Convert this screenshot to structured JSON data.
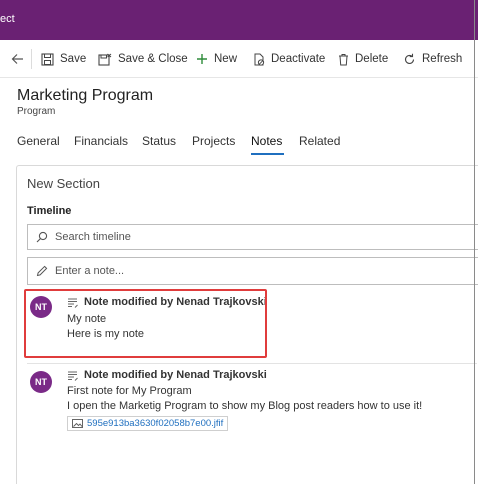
{
  "app": {
    "title_fragment": "ect"
  },
  "colors": {
    "title_bar": "#6a2173",
    "avatar": "#7a2a87",
    "accent": "#1f6fbf",
    "highlight": "#e03c3c"
  },
  "command_bar": {
    "save": "Save",
    "save_close": "Save & Close",
    "new": "New",
    "deactivate": "Deactivate",
    "delete": "Delete",
    "refresh": "Refresh"
  },
  "record": {
    "title": "Marketing Program",
    "entity": "Program"
  },
  "tabs": [
    "General",
    "Financials",
    "Status",
    "Projects",
    "Notes",
    "Related"
  ],
  "active_tab": "Notes",
  "section": {
    "title": "New Section",
    "timeline_label": "Timeline"
  },
  "search": {
    "placeholder": "Search timeline"
  },
  "note_input": {
    "placeholder": "Enter a note..."
  },
  "timeline": [
    {
      "initials": "NT",
      "header": "Note modified by Nenad Trajkovski",
      "title": "My note",
      "body": "Here is my note"
    },
    {
      "initials": "NT",
      "header": "Note modified by Nenad Trajkovski",
      "title": "First note for My Program",
      "body": "I open the Marketig Program to show my Blog post readers how to use it!",
      "attachment": "595e913ba3630f02058b7e00.jfif"
    }
  ]
}
